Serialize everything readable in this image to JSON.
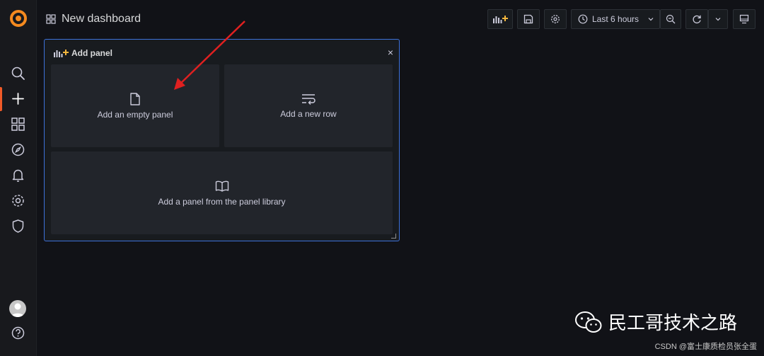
{
  "header": {
    "title": "New dashboard"
  },
  "toolbar": {
    "time_range": "Last 6 hours"
  },
  "add_panel": {
    "title": "Add panel",
    "close": "×",
    "options": {
      "empty": "Add an empty panel",
      "row": "Add a new row",
      "library": "Add a panel from the panel library"
    }
  },
  "watermark": {
    "text": "民工哥技术之路"
  },
  "credit": {
    "text": "CSDN @富士康质检员张全蛋"
  },
  "colors": {
    "accent": "#f05a28",
    "selection": "#3d71d9",
    "arrow": "#e02020"
  },
  "sidebar": {
    "icons": [
      "grafana-logo-icon",
      "search-icon",
      "plus-icon",
      "dashboards-icon",
      "explore-icon",
      "alerting-icon",
      "settings-icon",
      "shield-icon",
      "avatar",
      "help-icon"
    ]
  }
}
